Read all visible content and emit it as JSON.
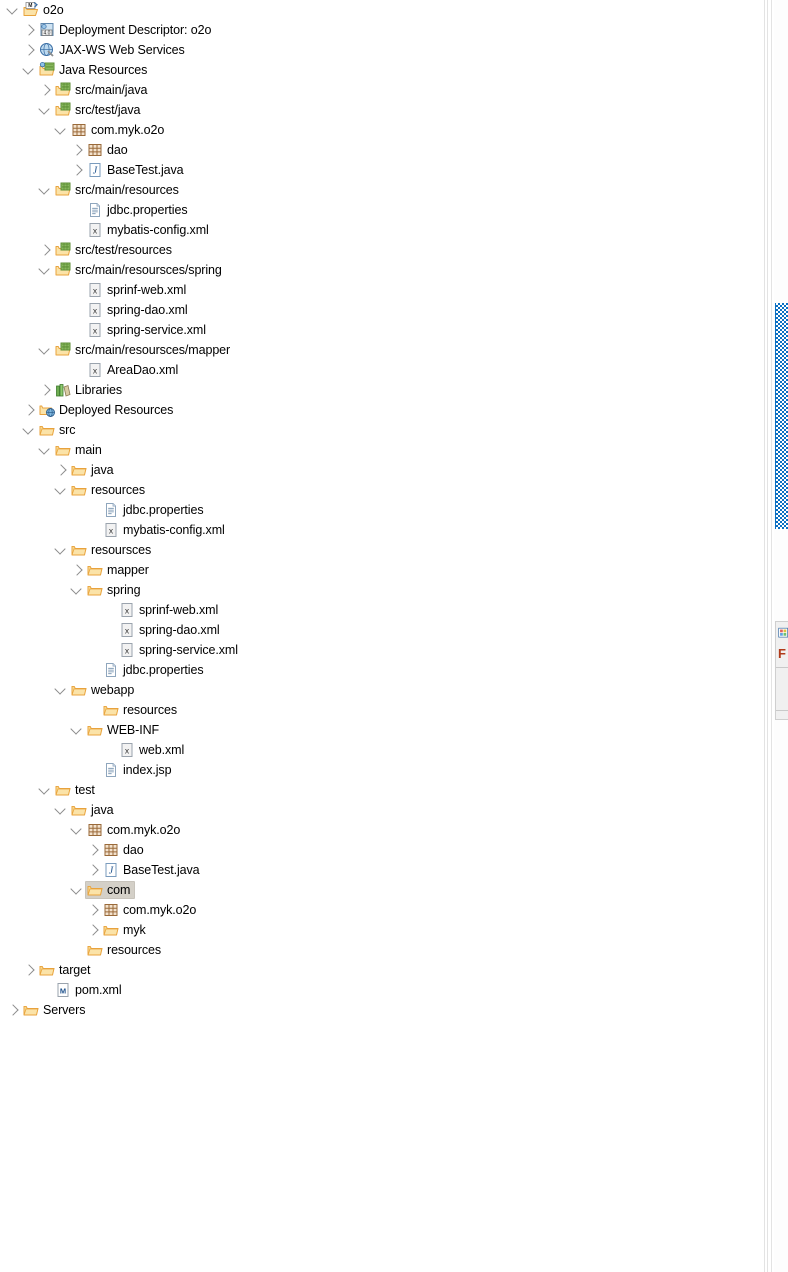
{
  "view": {
    "name": "Project Explorer",
    "selection_color": "#d4d0c8",
    "scrollbar_color": "#0a6fc2",
    "background": "#ffffff"
  },
  "tree": {
    "rows": [
      {
        "label": "o2o",
        "depth": 0,
        "twisty": "expanded",
        "icon": "maven-project-icon"
      },
      {
        "label": "Deployment Descriptor: o2o",
        "depth": 1,
        "twisty": "collapsed",
        "icon": "deployment-descriptor-icon"
      },
      {
        "label": "JAX-WS Web Services",
        "depth": 1,
        "twisty": "collapsed",
        "icon": "jaxws-icon"
      },
      {
        "label": "Java Resources",
        "depth": 1,
        "twisty": "expanded",
        "icon": "java-resources-icon"
      },
      {
        "label": "src/main/java",
        "depth": 2,
        "twisty": "collapsed",
        "icon": "source-folder-icon"
      },
      {
        "label": "src/test/java",
        "depth": 2,
        "twisty": "expanded",
        "icon": "source-folder-icon"
      },
      {
        "label": "com.myk.o2o",
        "depth": 3,
        "twisty": "expanded",
        "icon": "package-icon"
      },
      {
        "label": "dao",
        "depth": 4,
        "twisty": "collapsed",
        "icon": "package-icon"
      },
      {
        "label": "BaseTest.java",
        "depth": 4,
        "twisty": "collapsed",
        "icon": "java-file-icon"
      },
      {
        "label": "src/main/resources",
        "depth": 2,
        "twisty": "expanded",
        "icon": "source-folder-icon"
      },
      {
        "label": "jdbc.properties",
        "depth": 4,
        "twisty": "none",
        "icon": "properties-file-icon"
      },
      {
        "label": "mybatis-config.xml",
        "depth": 4,
        "twisty": "none",
        "icon": "xml-file-icon"
      },
      {
        "label": "src/test/resources",
        "depth": 2,
        "twisty": "collapsed",
        "icon": "source-folder-icon"
      },
      {
        "label": "src/main/resoursces/spring",
        "depth": 2,
        "twisty": "expanded",
        "icon": "source-folder-icon"
      },
      {
        "label": "sprinf-web.xml",
        "depth": 4,
        "twisty": "none",
        "icon": "xml-file-icon"
      },
      {
        "label": "spring-dao.xml",
        "depth": 4,
        "twisty": "none",
        "icon": "xml-file-icon"
      },
      {
        "label": "spring-service.xml",
        "depth": 4,
        "twisty": "none",
        "icon": "xml-file-icon"
      },
      {
        "label": "src/main/resoursces/mapper",
        "depth": 2,
        "twisty": "expanded",
        "icon": "source-folder-icon"
      },
      {
        "label": "AreaDao.xml",
        "depth": 4,
        "twisty": "none",
        "icon": "xml-file-icon"
      },
      {
        "label": "Libraries",
        "depth": 2,
        "twisty": "collapsed",
        "icon": "libraries-icon"
      },
      {
        "label": "Deployed Resources",
        "depth": 1,
        "twisty": "collapsed",
        "icon": "deployed-resources-icon"
      },
      {
        "label": "src",
        "depth": 1,
        "twisty": "expanded",
        "icon": "folder-icon"
      },
      {
        "label": "main",
        "depth": 2,
        "twisty": "expanded",
        "icon": "folder-icon"
      },
      {
        "label": "java",
        "depth": 3,
        "twisty": "collapsed",
        "icon": "folder-icon"
      },
      {
        "label": "resources",
        "depth": 3,
        "twisty": "expanded",
        "icon": "folder-icon"
      },
      {
        "label": "jdbc.properties",
        "depth": 5,
        "twisty": "none",
        "icon": "properties-file-icon"
      },
      {
        "label": "mybatis-config.xml",
        "depth": 5,
        "twisty": "none",
        "icon": "xml-file-icon"
      },
      {
        "label": "resoursces",
        "depth": 3,
        "twisty": "expanded",
        "icon": "folder-icon"
      },
      {
        "label": "mapper",
        "depth": 4,
        "twisty": "collapsed",
        "icon": "folder-icon"
      },
      {
        "label": "spring",
        "depth": 4,
        "twisty": "expanded",
        "icon": "folder-icon"
      },
      {
        "label": "sprinf-web.xml",
        "depth": 6,
        "twisty": "none",
        "icon": "xml-file-icon"
      },
      {
        "label": "spring-dao.xml",
        "depth": 6,
        "twisty": "none",
        "icon": "xml-file-icon"
      },
      {
        "label": "spring-service.xml",
        "depth": 6,
        "twisty": "none",
        "icon": "xml-file-icon"
      },
      {
        "label": "jdbc.properties",
        "depth": 5,
        "twisty": "none",
        "icon": "properties-file-icon"
      },
      {
        "label": "webapp",
        "depth": 3,
        "twisty": "expanded",
        "icon": "folder-icon"
      },
      {
        "label": "resources",
        "depth": 5,
        "twisty": "none",
        "icon": "folder-icon"
      },
      {
        "label": "WEB-INF",
        "depth": 4,
        "twisty": "expanded",
        "icon": "folder-icon"
      },
      {
        "label": "web.xml",
        "depth": 6,
        "twisty": "none",
        "icon": "xml-file-icon"
      },
      {
        "label": "index.jsp",
        "depth": 5,
        "twisty": "none",
        "icon": "jsp-file-icon"
      },
      {
        "label": "test",
        "depth": 2,
        "twisty": "expanded",
        "icon": "folder-icon"
      },
      {
        "label": "java",
        "depth": 3,
        "twisty": "expanded",
        "icon": "folder-icon"
      },
      {
        "label": "com.myk.o2o",
        "depth": 4,
        "twisty": "expanded",
        "icon": "package-icon"
      },
      {
        "label": "dao",
        "depth": 5,
        "twisty": "collapsed",
        "icon": "package-icon"
      },
      {
        "label": "BaseTest.java",
        "depth": 5,
        "twisty": "collapsed",
        "icon": "java-file-icon"
      },
      {
        "label": "com",
        "depth": 4,
        "twisty": "expanded",
        "icon": "folder-icon",
        "selected": true
      },
      {
        "label": "com.myk.o2o",
        "depth": 5,
        "twisty": "collapsed",
        "icon": "package-icon"
      },
      {
        "label": "myk",
        "depth": 5,
        "twisty": "collapsed",
        "icon": "folder-icon"
      },
      {
        "label": "resources",
        "depth": 4,
        "twisty": "none",
        "icon": "folder-icon"
      },
      {
        "label": "target",
        "depth": 1,
        "twisty": "collapsed",
        "icon": "folder-icon"
      },
      {
        "label": "pom.xml",
        "depth": 2,
        "twisty": "none",
        "icon": "maven-pom-icon"
      },
      {
        "label": "Servers",
        "depth": 0,
        "twisty": "collapsed",
        "icon": "folder-icon"
      }
    ]
  },
  "side_panel": {
    "letter": "F",
    "icon": "palette-icon"
  }
}
